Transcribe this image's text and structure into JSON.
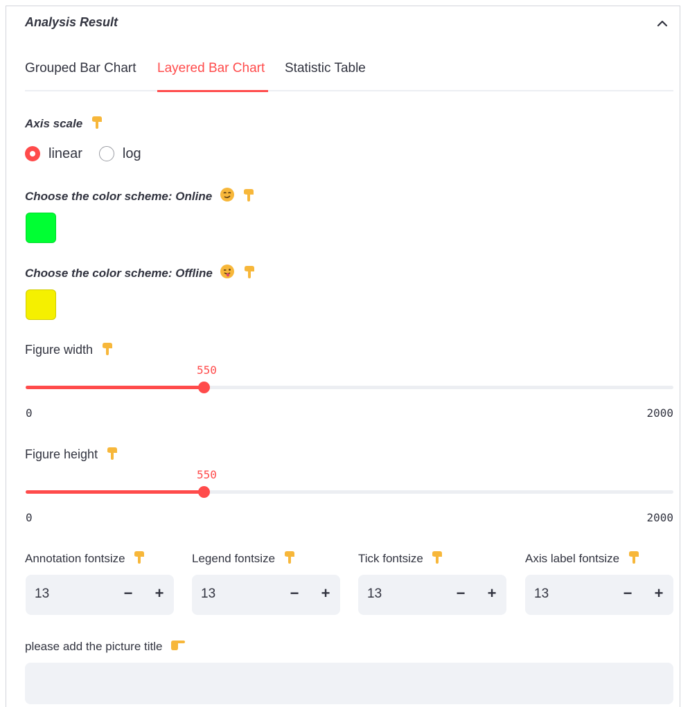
{
  "expander": {
    "title": "Analysis Result",
    "collapse_icon": "chevron-up-icon"
  },
  "tabs": [
    {
      "label": "Grouped Bar Chart",
      "active": false
    },
    {
      "label": "Layered Bar Chart",
      "active": true
    },
    {
      "label": "Statistic Table",
      "active": false
    }
  ],
  "axis_scale": {
    "label": "Axis scale",
    "icon": "pointing-down-emoji",
    "options": [
      "linear",
      "log"
    ],
    "selected": "linear"
  },
  "color_online": {
    "label": "Choose the color scheme: Online",
    "emoji": "smirking-face-emoji",
    "value": "#00ff33"
  },
  "color_offline": {
    "label": "Choose the color scheme: Offline",
    "emoji": "winking-tongue-face-emoji",
    "value": "#f5f000"
  },
  "figure_width": {
    "label": "Figure width",
    "value": "550",
    "min": "0",
    "max": "2000",
    "fraction": 0.275
  },
  "figure_height": {
    "label": "Figure height",
    "value": "550",
    "min": "0",
    "max": "2000",
    "fraction": 0.275
  },
  "fontsizes": [
    {
      "label": "Annotation fontsize",
      "value": "13"
    },
    {
      "label": "Legend fontsize",
      "value": "13"
    },
    {
      "label": "Tick fontsize",
      "value": "13"
    },
    {
      "label": "Axis label fontsize",
      "value": "13"
    }
  ],
  "stepper": {
    "minus": "−",
    "plus": "+"
  },
  "picture_title": {
    "label": "please add the picture title",
    "icon": "pointing-right-emoji",
    "value": ""
  },
  "colors": {
    "accent": "#ff4b4b",
    "input_bg": "#f0f2f6",
    "text": "#31333f"
  }
}
